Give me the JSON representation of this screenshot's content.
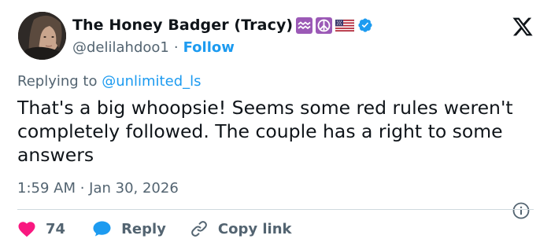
{
  "author": {
    "display_name": "The Honey Badger (Tracy)",
    "name_emojis": [
      "aquarius-emoji",
      "peace-emoji",
      "us-flag-emoji"
    ],
    "handle": "@delilahdoo1",
    "separator": "·",
    "follow_label": "Follow",
    "verified": true
  },
  "reply": {
    "prefix": "Replying to ",
    "mention": "@unlimited_ls"
  },
  "tweet": {
    "text": "That's a big whoopsie! Seems some red rules weren't completely followed. The couple has a right to some answers",
    "timestamp": "1:59 AM · Jan 30, 2026"
  },
  "actions": {
    "like_count": "74",
    "reply_label": "Reply",
    "copy_label": "Copy link"
  },
  "colors": {
    "accent": "#1d9bf0",
    "like": "#f91880",
    "secondary_text": "#536471",
    "primary_text": "#0f1419",
    "divider": "#cfd9de"
  },
  "icons": {
    "logo": "x-logo-icon",
    "verified": "verified-badge-icon",
    "info": "info-icon",
    "like": "heart-icon",
    "reply": "speech-bubble-icon",
    "copy": "link-icon"
  }
}
